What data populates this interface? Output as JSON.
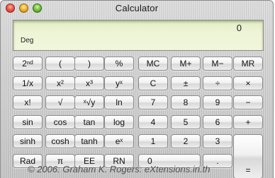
{
  "window": {
    "title": "Calculator"
  },
  "display": {
    "value": "0",
    "mode": "Deg"
  },
  "buttons": {
    "second": "2ⁿᵈ",
    "paren_open": "(",
    "paren_close": ")",
    "percent": "%",
    "mc": "MC",
    "m_plus": "M+",
    "m_minus": "M−",
    "mr": "MR",
    "reciprocal": "1/x",
    "square": "x²",
    "cube": "x³",
    "power": "yˣ",
    "clear": "C",
    "plus_minus": "±",
    "divide": "÷",
    "multiply": "×",
    "factorial": "x!",
    "sqrt": "√",
    "yroot": "ˣ√y",
    "ln": "ln",
    "seven": "7",
    "eight": "8",
    "nine": "9",
    "minus": "−",
    "sin": "sin",
    "cos": "cos",
    "tan": "tan",
    "log": "log",
    "four": "4",
    "five": "5",
    "six": "6",
    "plus": "+",
    "sinh": "sinh",
    "cosh": "cosh",
    "tanh": "tanh",
    "exp": "eˣ",
    "one": "1",
    "two": "2",
    "three": "3",
    "equals": "=",
    "rad": "Rad",
    "pi": "π",
    "ee": "EE",
    "rn": "RN",
    "zero": "0",
    "decimal": "."
  },
  "copyright": "© 2006: Graham K. Rogers: eXtensions.in.th",
  "colors": {
    "display_background": "#eef4d6",
    "window_background": "#c9c9c9",
    "close_button": "#ee5b4d",
    "minimize_button": "#f2b733",
    "zoom_button": "#7cc443"
  },
  "icons": {
    "close": "red-circle",
    "minimize": "yellow-circle",
    "zoom": "green-circle"
  }
}
